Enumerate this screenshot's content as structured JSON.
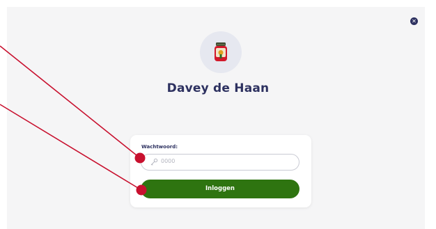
{
  "modal": {
    "close_icon": "close-icon",
    "user_name": "Davey de Haan",
    "avatar_icon": "jar-icon"
  },
  "login": {
    "password_label": "Wachtwoord:",
    "password_placeholder": "0000",
    "password_icon": "key-icon",
    "submit_label": "Inloggen"
  },
  "colors": {
    "title": "#2d3160",
    "button": "#2e7410",
    "annotation": "#c8102e"
  }
}
